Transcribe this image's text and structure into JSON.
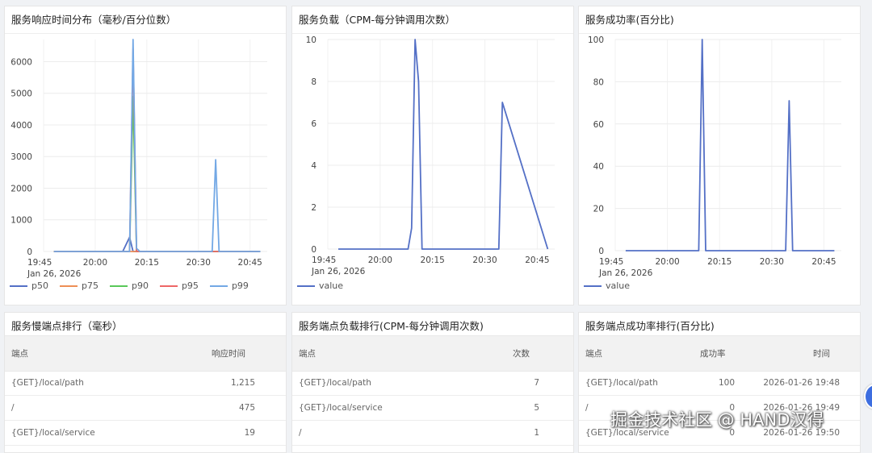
{
  "colors": {
    "series_blue": "#5470c6",
    "p50": "#5470c6",
    "p75": "#ee8e55",
    "p90": "#59c859",
    "p95": "#ee6666",
    "p99": "#73a8e5"
  },
  "charts": {
    "c1": {
      "title": "服务响应时间分布（毫秒/百分位数）"
    },
    "c2": {
      "title": "服务负载（CPM-每分钟调用次数）"
    },
    "c3": {
      "title": "服务成功率(百分比)"
    }
  },
  "chart_data": [
    {
      "type": "line",
      "title": "服务响应时间分布（毫秒/百分位数）",
      "x_ticks": [
        "19:45",
        "20:00",
        "20:15",
        "20:30",
        "20:45"
      ],
      "x_date_label": "Jan 26, 2026",
      "y_ticks": [
        "0",
        "1000",
        "2000",
        "3000",
        "4000",
        "5000",
        "6000"
      ],
      "ylim": [
        0,
        6700
      ],
      "x": [
        "19:48",
        "20:08",
        "20:10",
        "20:11",
        "20:12",
        "20:13",
        "20:34",
        "20:35",
        "20:36",
        "20:48"
      ],
      "series": [
        {
          "name": "p50",
          "values": [
            0,
            0,
            450,
            0,
            0,
            0,
            0,
            0,
            0,
            0
          ]
        },
        {
          "name": "p75",
          "values": [
            0,
            0,
            0,
            0,
            0,
            0,
            0,
            0,
            0,
            0
          ]
        },
        {
          "name": "p90",
          "values": [
            0,
            0,
            0,
            4900,
            0,
            0,
            0,
            0,
            0,
            0
          ]
        },
        {
          "name": "p95",
          "values": [
            0,
            0,
            0,
            6400,
            0,
            0,
            0,
            0,
            0,
            0
          ]
        },
        {
          "name": "p99",
          "values": [
            0,
            0,
            0,
            6700,
            100,
            0,
            0,
            2900,
            0,
            0
          ]
        }
      ],
      "legend_position": "bottom-left"
    },
    {
      "type": "line",
      "title": "服务负载（CPM-每分钟调用次数）",
      "x_ticks": [
        "19:45",
        "20:00",
        "20:15",
        "20:30",
        "20:45"
      ],
      "x_date_label": "Jan 26, 2026",
      "y_ticks": [
        "0",
        "2",
        "4",
        "6",
        "8",
        "10"
      ],
      "ylim": [
        0,
        10
      ],
      "x": [
        "19:48",
        "20:08",
        "20:09",
        "20:10",
        "20:11",
        "20:12",
        "20:33",
        "20:34",
        "20:35",
        "20:48"
      ],
      "series": [
        {
          "name": "value",
          "values": [
            0,
            0,
            1,
            10,
            8,
            0,
            0,
            0,
            7,
            0
          ]
        }
      ],
      "legend_position": "bottom-left"
    },
    {
      "type": "line",
      "title": "服务成功率(百分比)",
      "x_ticks": [
        "19:45",
        "20:00",
        "20:15",
        "20:30",
        "20:45"
      ],
      "x_date_label": "Jan 26, 2026",
      "y_ticks": [
        "0",
        "20",
        "40",
        "60",
        "80",
        "100"
      ],
      "ylim": [
        0,
        100
      ],
      "x": [
        "19:48",
        "20:09",
        "20:10",
        "20:11",
        "20:34",
        "20:35",
        "20:36",
        "20:48"
      ],
      "series": [
        {
          "name": "value",
          "values": [
            0,
            0,
            100,
            0,
            0,
            71,
            0,
            0
          ]
        }
      ],
      "legend_position": "bottom-left"
    }
  ],
  "tables": {
    "t1": {
      "title": "服务慢端点排行（毫秒）",
      "columns": [
        "端点",
        "响应时间"
      ],
      "rows": [
        [
          "{GET}/local/path",
          "1,215"
        ],
        [
          "/",
          "475"
        ],
        [
          "{GET}/local/service",
          "19"
        ]
      ]
    },
    "t2": {
      "title": "服务端点负载排行(CPM-每分钟调用次数)",
      "columns": [
        "端点",
        "次数"
      ],
      "rows": [
        [
          "{GET}/local/path",
          "7"
        ],
        [
          "{GET}/local/service",
          "5"
        ],
        [
          "/",
          "1"
        ]
      ]
    },
    "t3": {
      "title": "服务端点成功率排行(百分比)",
      "columns": [
        "端点",
        "成功率",
        "时间"
      ],
      "rows": [
        [
          "{GET}/local/path",
          "100",
          "2026-01-26 19:48"
        ],
        [
          "/",
          "0",
          "2026-01-26 19:49"
        ],
        [
          "{GET}/local/service",
          "0",
          "2026-01-26 19:50"
        ]
      ]
    }
  },
  "watermark": "掘金技术社区 @ HAND汉得"
}
